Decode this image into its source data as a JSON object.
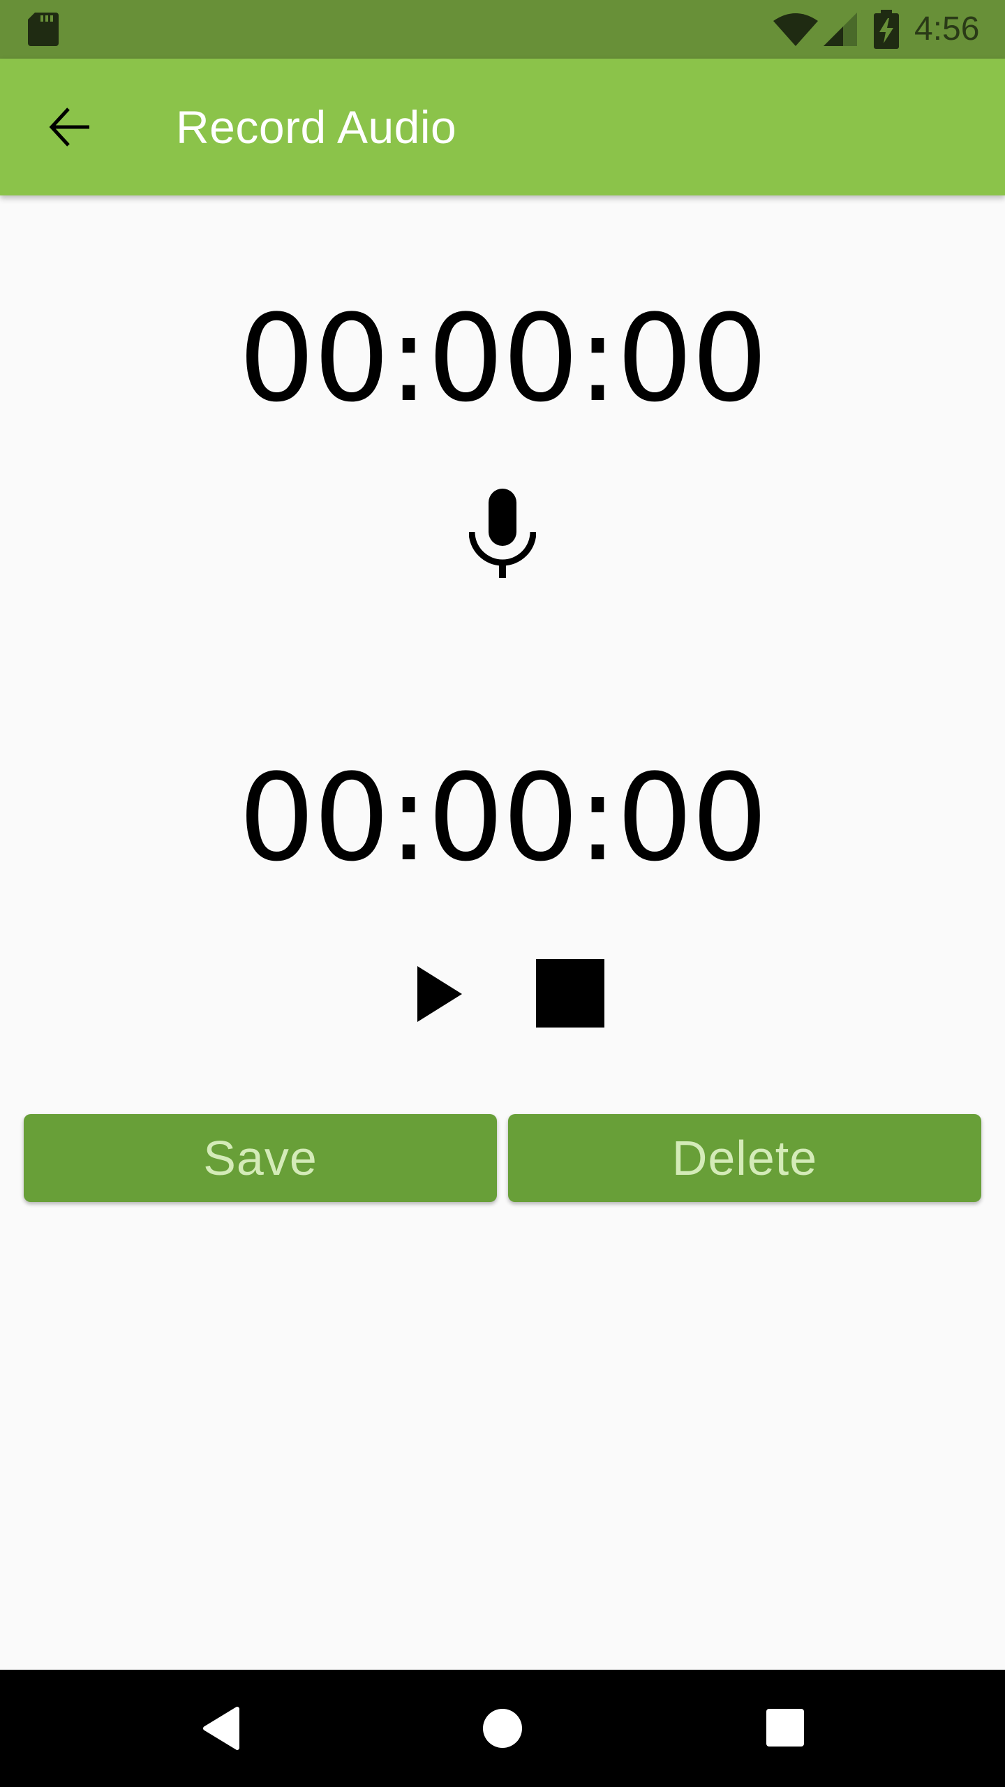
{
  "status_bar": {
    "time": "4:56",
    "icons": [
      "sd-card-icon",
      "wifi-icon",
      "signal-icon",
      "battery-charging-icon"
    ],
    "background_color": "#689038"
  },
  "app_bar": {
    "title": "Record Audio",
    "back_icon": "arrow-back-icon",
    "background_color": "#8bc34a"
  },
  "recorder": {
    "record_timer": "00:00:00",
    "mic_icon": "microphone-icon",
    "playback_timer": "00:00:00",
    "play_icon": "play-icon",
    "stop_icon": "stop-icon"
  },
  "actions": {
    "save_label": "Save",
    "delete_label": "Delete",
    "button_color": "#689f38",
    "button_text_color": "#d4ebb8"
  },
  "nav_bar": {
    "icons": [
      "nav-back-icon",
      "nav-home-icon",
      "nav-recents-icon"
    ]
  }
}
